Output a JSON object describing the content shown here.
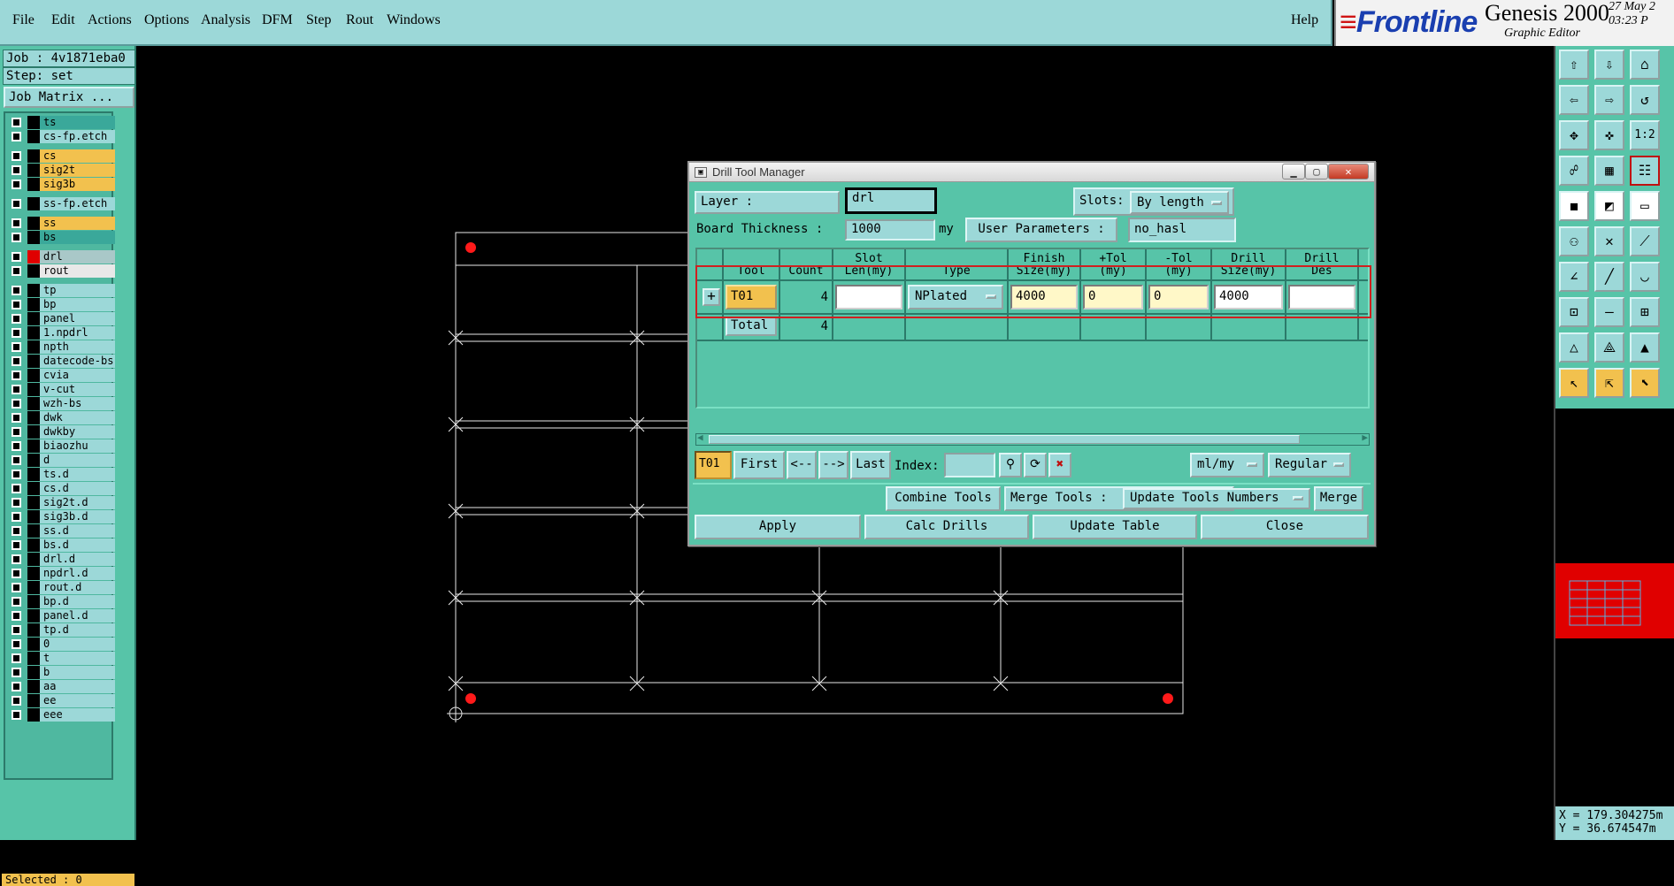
{
  "menu": {
    "file": "File",
    "edit": "Edit",
    "actions": "Actions",
    "options": "Options",
    "analysis": "Analysis",
    "dfm": "DFM",
    "step": "Step",
    "rout": "Rout",
    "windows": "Windows",
    "help": "Help"
  },
  "branding": {
    "frontline": "Frontline",
    "product": "Genesis 2000",
    "editor": "Graphic Editor",
    "date": "27 May 2",
    "time": "03:23 P"
  },
  "left": {
    "job": "Job : 4v1871eba0",
    "step": "Step: set",
    "job_matrix": "Job Matrix ...",
    "selected": "Selected : 0",
    "layers": [
      {
        "name": "ts",
        "type": "board"
      },
      {
        "name": "cs-fp.etch",
        "type": "misc"
      },
      {
        "name": "cs",
        "type": "sig"
      },
      {
        "name": "sig2t",
        "type": "sig"
      },
      {
        "name": "sig3b",
        "type": "sig"
      },
      {
        "name": "ss-fp.etch",
        "type": "misc"
      },
      {
        "name": "ss",
        "type": "sig"
      },
      {
        "name": "bs",
        "type": "board"
      },
      {
        "name": "drl",
        "type": "drl"
      },
      {
        "name": "rout",
        "type": "rout"
      },
      {
        "name": "tp",
        "type": "misc"
      },
      {
        "name": "bp",
        "type": "misc"
      },
      {
        "name": "panel",
        "type": "misc"
      },
      {
        "name": "1.npdrl",
        "type": "misc"
      },
      {
        "name": "npth",
        "type": "misc"
      },
      {
        "name": "datecode-bs",
        "type": "misc"
      },
      {
        "name": "cvia",
        "type": "misc"
      },
      {
        "name": "v-cut",
        "type": "misc"
      },
      {
        "name": "wzh-bs",
        "type": "misc"
      },
      {
        "name": "dwk",
        "type": "misc"
      },
      {
        "name": "dwkby",
        "type": "misc"
      },
      {
        "name": "biaozhu",
        "type": "misc"
      },
      {
        "name": "d",
        "type": "misc"
      },
      {
        "name": "ts.d",
        "type": "misc"
      },
      {
        "name": "cs.d",
        "type": "misc"
      },
      {
        "name": "sig2t.d",
        "type": "misc"
      },
      {
        "name": "sig3b.d",
        "type": "misc"
      },
      {
        "name": "ss.d",
        "type": "misc"
      },
      {
        "name": "bs.d",
        "type": "misc"
      },
      {
        "name": "drl.d",
        "type": "misc"
      },
      {
        "name": "npdrl.d",
        "type": "misc"
      },
      {
        "name": "rout.d",
        "type": "misc"
      },
      {
        "name": "bp.d",
        "type": "misc"
      },
      {
        "name": "panel.d",
        "type": "misc"
      },
      {
        "name": "tp.d",
        "type": "misc"
      },
      {
        "name": "0",
        "type": "misc"
      },
      {
        "name": "t",
        "type": "misc"
      },
      {
        "name": "b",
        "type": "misc"
      },
      {
        "name": "aa",
        "type": "misc"
      },
      {
        "name": "ee",
        "type": "misc"
      },
      {
        "name": "eee",
        "type": "misc"
      }
    ]
  },
  "right": {
    "scale_label": "1:2",
    "coord_x": "X = 179.304275m",
    "coord_y": "Y = 36.674547m"
  },
  "dialog": {
    "title": "Drill Tool Manager",
    "layer_label": "Layer          :",
    "layer_value": "drl",
    "slots_label": "Slots:",
    "slots_value": "By length",
    "board_thickness_label": "Board Thickness :",
    "board_thickness_value": "1000",
    "thickness_unit": "my",
    "user_params_label": "User Parameters :",
    "user_params_value": "no_hasl",
    "columns": {
      "tool": "Tool",
      "count": "Count",
      "slot_len": "Slot\nLen(my)",
      "type": "Type",
      "finish_size": "Finish\nSize(my)",
      "plus_tol": "+Tol\n(my)",
      "minus_tol": "-Tol\n(my)",
      "drill_size": "Drill\nSize(my)",
      "drill_des": "Drill\nDes"
    },
    "row": {
      "tool": "T01",
      "count": "4",
      "slot_len": "",
      "type": "NPlated",
      "finish_size": "4000",
      "plus_tol": "0",
      "minus_tol": "0",
      "drill_size": "4000",
      "drill_des": ""
    },
    "total": {
      "label": "Total",
      "count": "4"
    },
    "nav": {
      "current_tool": "T01",
      "first": "First",
      "prev": "<--",
      "next": "-->",
      "last": "Last",
      "index_label": "Index:",
      "index_value": "",
      "units": "ml/my",
      "mode": "Regular"
    },
    "actions": {
      "combine": "Combine Tools",
      "merge_label": "Merge Tools :",
      "merge_option": "Update Tools Numbers",
      "merge": "Merge",
      "apply": "Apply",
      "calc": "Calc Drills",
      "update": "Update Table",
      "close": "Close"
    }
  }
}
